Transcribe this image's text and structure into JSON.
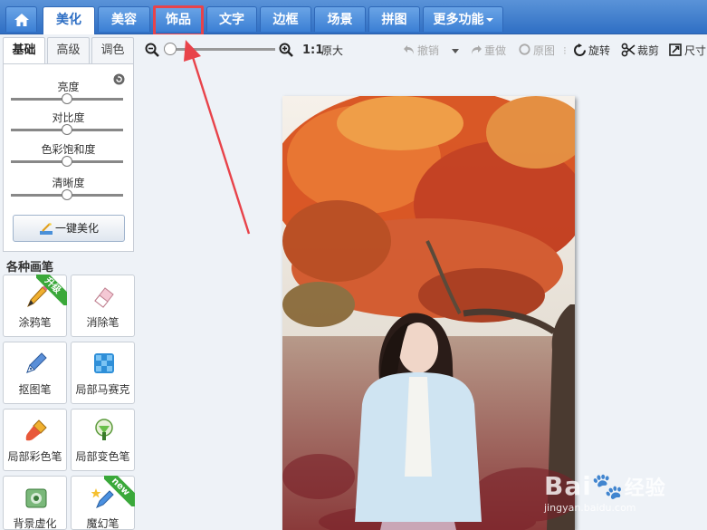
{
  "nav": {
    "tabs": [
      {
        "label": "美化",
        "active": true
      },
      {
        "label": "美容",
        "active": false
      },
      {
        "label": "饰品",
        "active": false
      },
      {
        "label": "文字",
        "active": false
      },
      {
        "label": "边框",
        "active": false
      },
      {
        "label": "场景",
        "active": false
      },
      {
        "label": "拼图",
        "active": false
      }
    ],
    "more_label": "更多功能"
  },
  "toolbar": {
    "ratio_label": "1:1",
    "original_size_label": "原大",
    "undo_label": "撤销",
    "redo_label": "重做",
    "original_label": "原图",
    "rotate_label": "旋转",
    "crop_label": "裁剪",
    "size_label": "尺寸"
  },
  "panel": {
    "tabs": [
      {
        "label": "基础",
        "active": true
      },
      {
        "label": "高级",
        "active": false
      },
      {
        "label": "调色",
        "active": false
      }
    ],
    "adjustments": [
      {
        "label": "亮度",
        "value": 50
      },
      {
        "label": "对比度",
        "value": 50
      },
      {
        "label": "色彩饱和度",
        "value": 50
      },
      {
        "label": "清晰度",
        "value": 50
      }
    ],
    "one_key_label": "一键美化",
    "brush_section_title": "各种画笔",
    "brushes": [
      {
        "label": "涂鸦笔",
        "badge": "升级",
        "icon": "pencil-icon"
      },
      {
        "label": "消除笔",
        "badge": "",
        "icon": "eraser-icon"
      },
      {
        "label": "抠图笔",
        "badge": "",
        "icon": "cutout-pen-icon"
      },
      {
        "label": "局部马赛克",
        "badge": "",
        "icon": "mosaic-icon"
      },
      {
        "label": "局部彩色笔",
        "badge": "",
        "icon": "color-brush-icon"
      },
      {
        "label": "局部变色笔",
        "badge": "",
        "icon": "recolor-brush-icon"
      },
      {
        "label": "背景虚化",
        "badge": "",
        "icon": "background-blur-icon"
      },
      {
        "label": "魔幻笔",
        "badge": "new",
        "icon": "magic-pen-icon"
      }
    ]
  },
  "watermark": {
    "brand": "Bai",
    "brand_suffix": "经验",
    "url": "jingyan.baidu.com"
  },
  "colors": {
    "nav_blue": "#2f6fc4",
    "highlight_red": "#e8434a",
    "badge_green": "#3aa83a"
  }
}
